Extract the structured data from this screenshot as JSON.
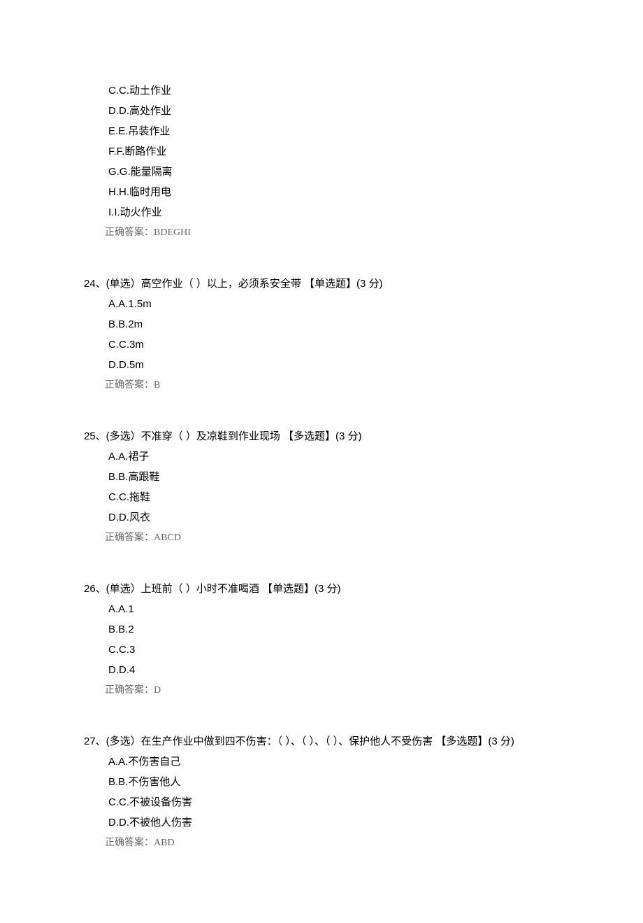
{
  "q23": {
    "options": [
      "C.C.动土作业",
      "D.D.高处作业",
      "E.E.吊装作业",
      "F.F.断路作业",
      "G.G.能量隔离",
      "H.H.临时用电",
      "I.I.动火作业"
    ],
    "answer": "正确答案：BDEGHI"
  },
  "q24": {
    "stem": "24、(单选）高空作业（ ）以上，必须系安全带 【单选题】(3 分)",
    "options": [
      "A.A.1.5m",
      "B.B.2m",
      "C.C.3m",
      "D.D.5m"
    ],
    "answer": "正确答案：B"
  },
  "q25": {
    "stem": "25、(多选）不准穿（ ）及凉鞋到作业现场 【多选题】(3 分)",
    "options": [
      "A.A.裙子",
      "B.B.高跟鞋",
      "C.C.拖鞋",
      "D.D.风衣"
    ],
    "answer": "正确答案：ABCD"
  },
  "q26": {
    "stem": "26、(单选）上班前（ ）小时不准喝酒 【单选题】(3 分)",
    "options": [
      "A.A.1",
      "B.B.2",
      "C.C.3",
      "D.D.4"
    ],
    "answer": "正确答案：D"
  },
  "q27": {
    "stem": "27、(多选）在生产作业中做到四不伤害：（    ）、（    ）、（    ）、保护他人不受伤害 【多选题】(3 分)",
    "options": [
      "A.A.不伤害自己",
      "B.B.不伤害他人",
      "C.C.不被设备伤害",
      "D.D.不被他人伤害"
    ],
    "answer": "正确答案：ABD"
  }
}
